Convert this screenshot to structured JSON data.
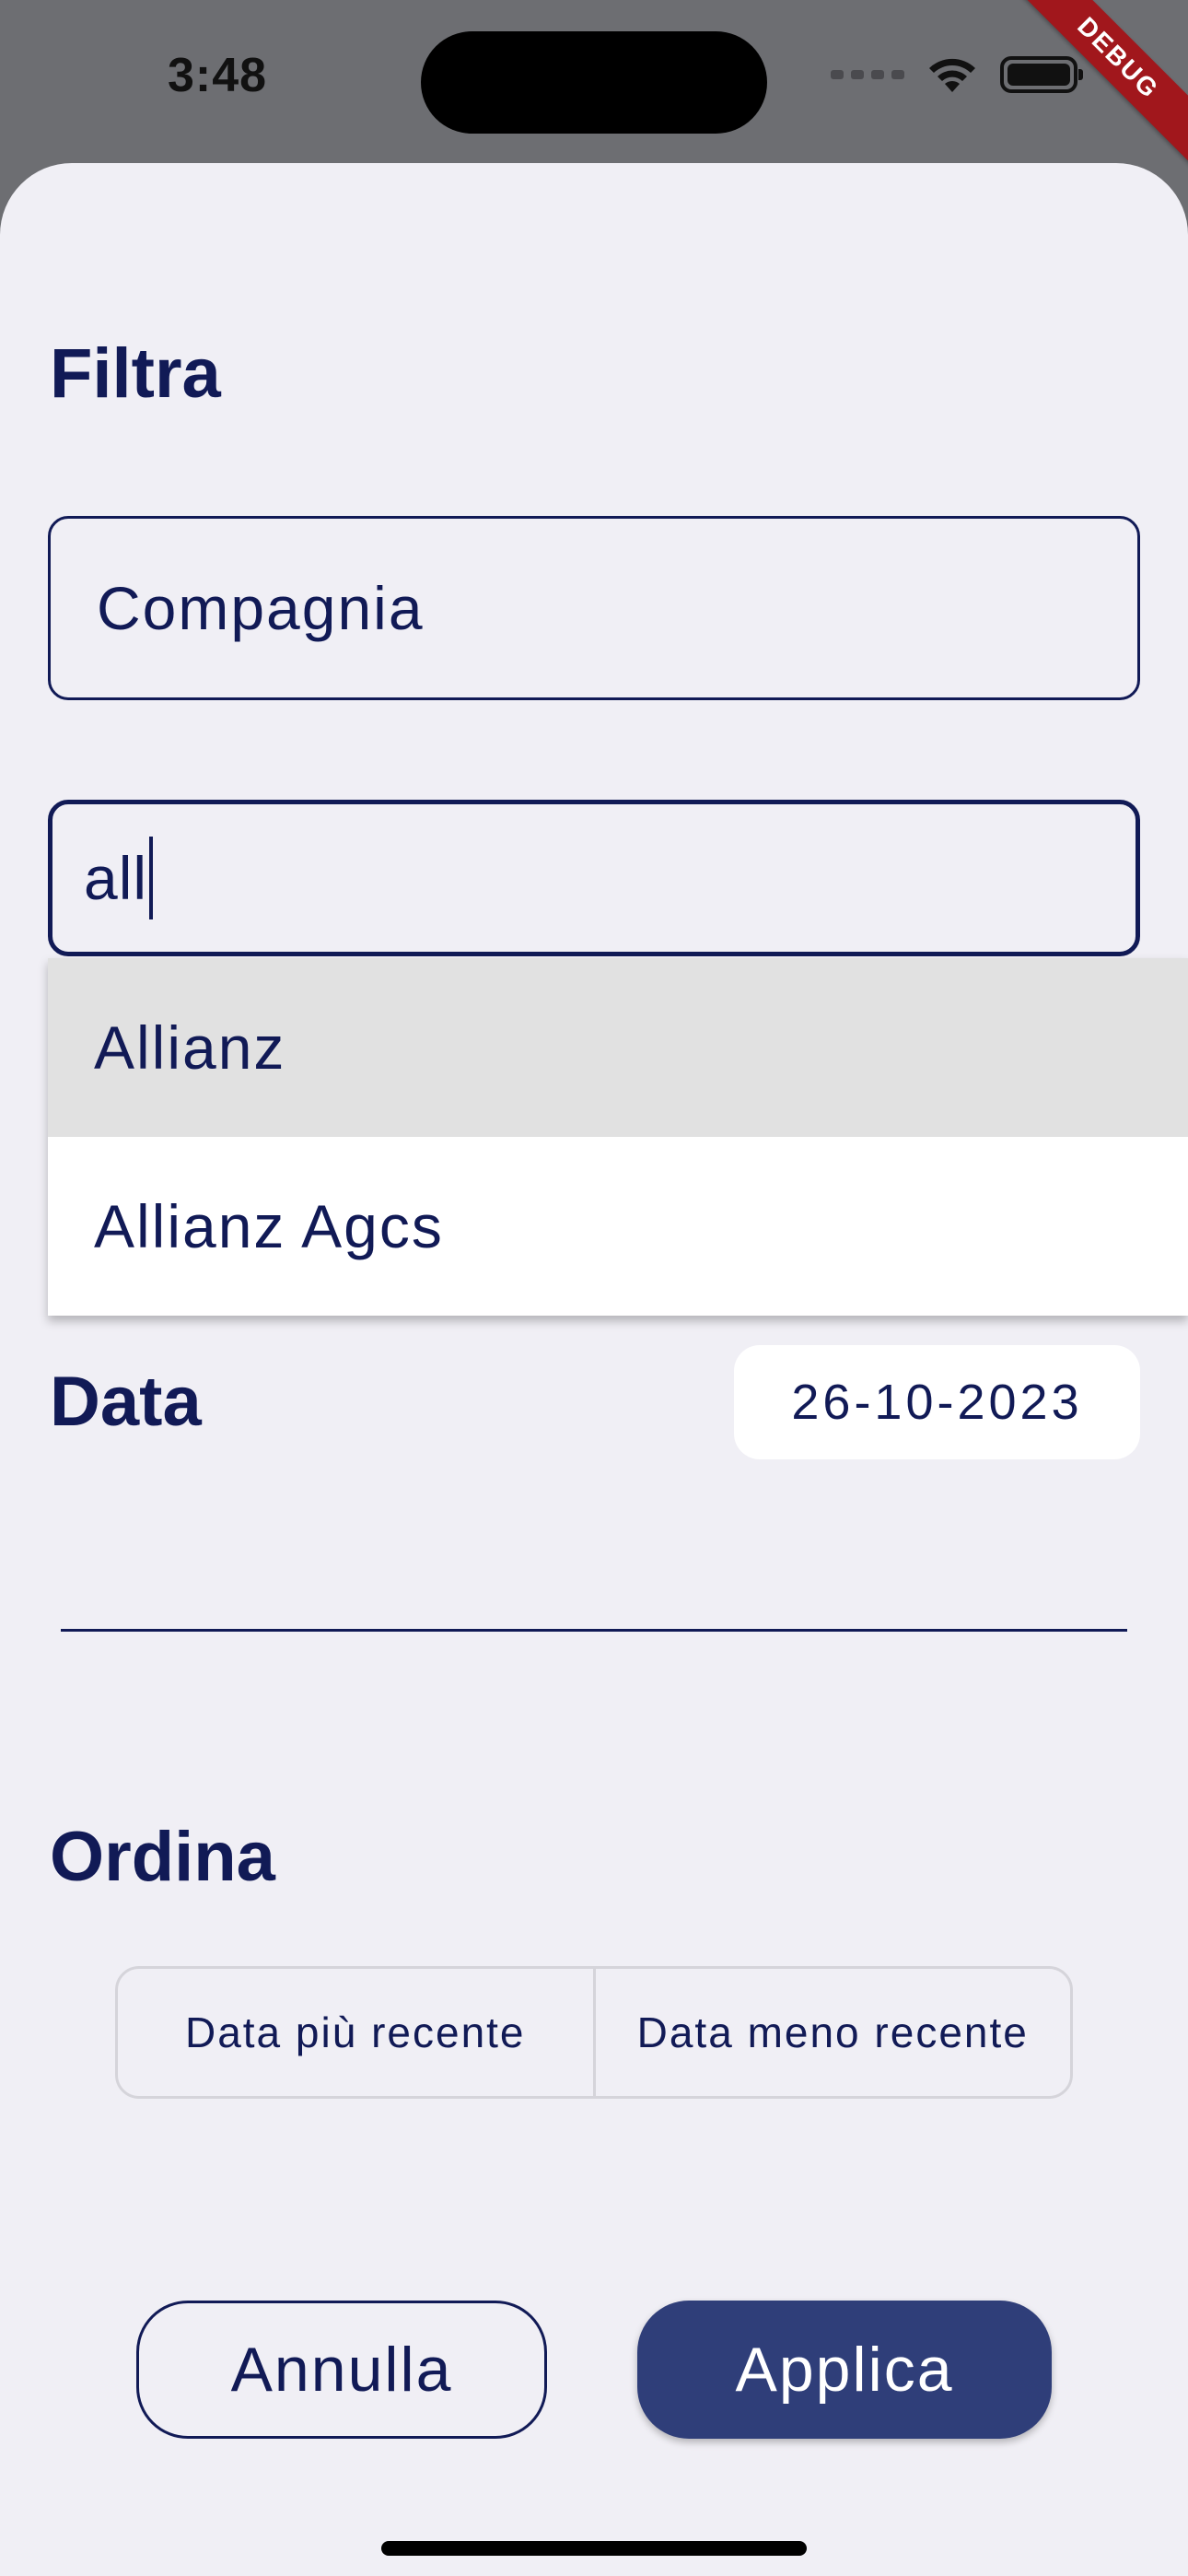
{
  "status_bar": {
    "time": "3:48",
    "icons": [
      "cellular-icon",
      "wifi-icon",
      "battery-icon"
    ]
  },
  "debug_banner": "DEBUG",
  "filter": {
    "title": "Filtra",
    "company_field": "Compagnia",
    "search_value": "all",
    "suggestions": [
      "Allianz",
      "Allianz Agcs"
    ]
  },
  "date": {
    "label": "Data",
    "value": "26-10-2023"
  },
  "sort": {
    "label": "Ordina",
    "options": [
      "Data più recente",
      "Data meno recente"
    ]
  },
  "actions": {
    "cancel": "Annulla",
    "apply": "Applica"
  },
  "colors": {
    "navy": "#111a56",
    "apply_button": "#2f3e79",
    "sheet_background": "#f0eff5",
    "debug_banner": "#a1171c"
  }
}
